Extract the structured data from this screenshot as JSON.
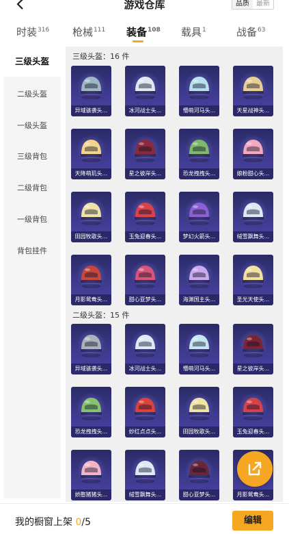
{
  "header": {
    "title": "游戏仓库",
    "sort_options": [
      "品质",
      "最新"
    ],
    "active_sort": "品质"
  },
  "categories": [
    {
      "label": "时装",
      "count": "316"
    },
    {
      "label": "枪械",
      "count": "111"
    },
    {
      "label": "装备",
      "count": "108"
    },
    {
      "label": "载具",
      "count": "1"
    },
    {
      "label": "战备",
      "count": "63"
    }
  ],
  "active_category": "装备",
  "sidebar": {
    "items": [
      "三级头盔",
      "二级头盔",
      "一级头盔",
      "三级背包",
      "二级背包",
      "一级背包",
      "背包挂件"
    ],
    "active": "三级头盔"
  },
  "sections": [
    {
      "title": "三级头盔：16 件",
      "items": [
        {
          "name": "异域骇袭头...",
          "color": "#9fb6c6"
        },
        {
          "name": "冰河战士头...",
          "color": "#dfe8f2"
        },
        {
          "name": "懵萌河马头...",
          "color": "#b7e0ee"
        },
        {
          "name": "天星战神头...",
          "color": "#e6cf95"
        },
        {
          "name": "天降萌玑头...",
          "color": "#f2d58a"
        },
        {
          "name": "星之彼岸头...",
          "color": "#8a2a3a"
        },
        {
          "name": "恐龙拽拽头...",
          "color": "#7fb86a"
        },
        {
          "name": "娘粉甜心头...",
          "color": "#f2a8bf"
        },
        {
          "name": "田园牧歌头...",
          "color": "#efe2a8"
        },
        {
          "name": "玉兔迎春头...",
          "color": "#d8434b"
        },
        {
          "name": "梦幻火箭头...",
          "color": "#8b5fd6"
        },
        {
          "name": "绒雪飘舞头...",
          "color": "#dbe9f5"
        },
        {
          "name": "月影鸳鸯头...",
          "color": "#c8463c"
        },
        {
          "name": "甜心亚梦头...",
          "color": "#d8557a"
        },
        {
          "name": "海渊国主头...",
          "color": "#c9a8ef"
        },
        {
          "name": "圣光天使头...",
          "color": "#f3df9e"
        }
      ]
    },
    {
      "title": "二级头盔：15 件",
      "items": [
        {
          "name": "异域骇袭头...",
          "color": "#aab3bb"
        },
        {
          "name": "冰河战士头...",
          "color": "#dde9f5"
        },
        {
          "name": "懵萌河马头...",
          "color": "#c7e5f1"
        },
        {
          "name": "星之彼岸头...",
          "color": "#7c2434"
        },
        {
          "name": "恐龙拽拽头...",
          "color": "#86c26f"
        },
        {
          "name": "妙红点点头...",
          "color": "#d9423d"
        },
        {
          "name": "田园牧歌头...",
          "color": "#efe4a6"
        },
        {
          "name": "玉兔迎春头...",
          "color": "#d6424a"
        },
        {
          "name": "娇憨猪猪头...",
          "color": "#f3b4c6"
        },
        {
          "name": "绒雪飘舞头...",
          "color": "#dde9f4"
        },
        {
          "name": "甜心亚梦头...",
          "color": "#6a2536"
        },
        {
          "name": "月影鸳鸯头...",
          "color": "#c9473d"
        }
      ]
    }
  ],
  "bottom": {
    "shelf_label": "我的橱窗上架",
    "shelf_count": "0",
    "shelf_total": "/5",
    "edit_label": "编辑"
  },
  "colors": {
    "accent": "#f5a623",
    "card_bg": "#3e3a8e"
  }
}
